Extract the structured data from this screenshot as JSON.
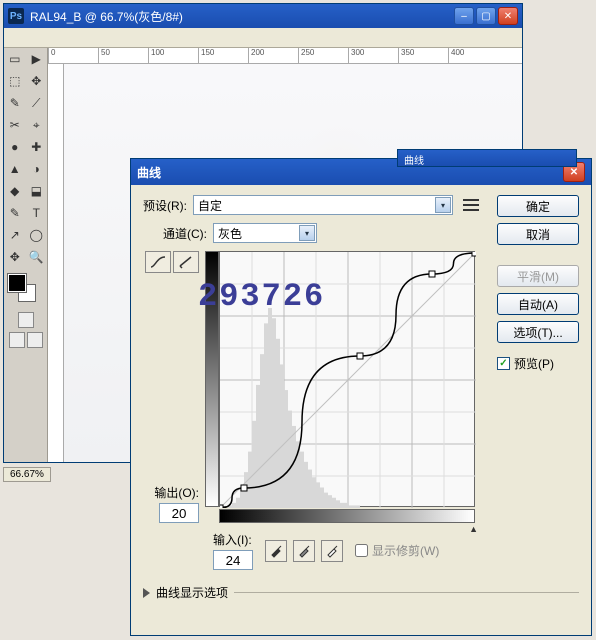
{
  "app": {
    "icon_text": "Ps",
    "title": "RAL94_B @ 66.7%(灰色/8#)",
    "zoom": "66.67%"
  },
  "ruler": [
    "0",
    "50",
    "100",
    "150",
    "200",
    "250",
    "300",
    "350",
    "400"
  ],
  "tools": {
    "row0": [
      "▭",
      "▶"
    ],
    "row1": [
      "⬚",
      "✥"
    ],
    "row2": [
      "✎",
      "⟋"
    ],
    "row3": [
      "✂",
      "⌖"
    ],
    "row4": [
      "●",
      "✚"
    ],
    "row5": [
      "▲",
      "◑"
    ],
    "row6": [
      "◆",
      "⬓"
    ],
    "row7": [
      "✎",
      "T"
    ],
    "row8": [
      "↗",
      "◯"
    ],
    "row9": [
      "✥",
      "🔍"
    ]
  },
  "dialog": {
    "shadow_title": "曲线",
    "title": "曲线",
    "preset_label": "预设(R):",
    "preset_value": "自定",
    "channel_label": "通道(C):",
    "channel_value": "灰色",
    "output_label": "输出(O):",
    "output_value": "20",
    "input_label": "输入(I):",
    "input_value": "24",
    "clip_label": "显示修剪(W)",
    "disclosure": "曲线显示选项",
    "ok": "确定",
    "cancel": "取消",
    "smooth": "平滑(M)",
    "auto": "自动(A)",
    "options": "选项(T)...",
    "preview": "预览(P)"
  },
  "watermark": "293726",
  "chart_data": {
    "type": "line",
    "title": "Curves",
    "xlabel": "输入",
    "ylabel": "输出",
    "xlim": [
      0,
      255
    ],
    "ylim": [
      0,
      255
    ],
    "series": [
      {
        "name": "curve",
        "points": [
          [
            0,
            0
          ],
          [
            24,
            20
          ],
          [
            140,
            152
          ],
          [
            212,
            234
          ],
          [
            255,
            255
          ]
        ]
      },
      {
        "name": "identity",
        "points": [
          [
            0,
            0
          ],
          [
            255,
            255
          ]
        ]
      }
    ],
    "histogram": [
      0,
      0,
      1,
      2,
      4,
      8,
      14,
      22,
      34,
      48,
      60,
      72,
      78,
      74,
      66,
      56,
      46,
      38,
      32,
      26,
      22,
      18,
      15,
      12,
      10,
      8,
      6,
      5,
      4,
      3,
      2,
      2,
      1,
      1,
      1,
      0,
      0,
      0,
      0,
      0,
      0,
      0,
      0,
      0,
      0,
      0,
      0,
      0,
      0,
      0,
      0,
      0,
      0,
      0,
      0,
      0,
      0,
      0,
      0,
      0,
      0,
      0,
      0,
      0
    ]
  }
}
